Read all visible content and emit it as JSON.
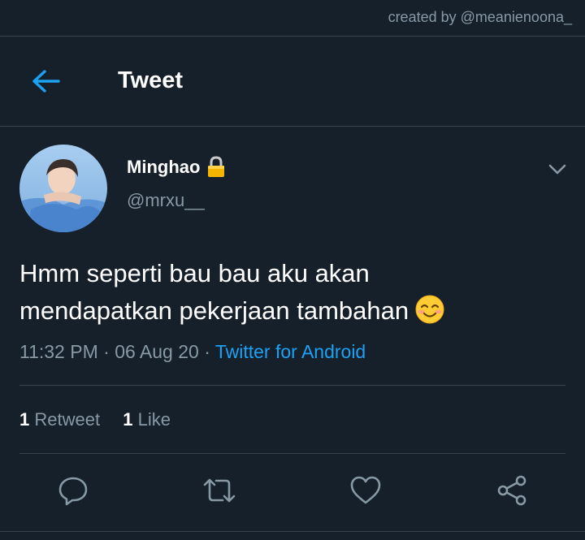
{
  "credit": "created by @meanienoona_",
  "header": {
    "title": "Tweet",
    "back_icon": "arrow-left-icon"
  },
  "tweet": {
    "display_name": "Minghao",
    "protected_icon": "lock-icon",
    "handle": "@mrxu__",
    "text_lines": [
      "Hmm seperti bau bau aku akan",
      "mendapatkan pekerjaan tambahan"
    ],
    "emoji": "smiling-face-icon",
    "time": "11:32 PM",
    "date": "06 Aug 20",
    "separator": "·",
    "source": "Twitter for Android",
    "retweets": {
      "count": "1",
      "label": "Retweet"
    },
    "likes": {
      "count": "1",
      "label": "Like"
    }
  },
  "actions": [
    "reply-icon",
    "retweet-icon",
    "like-icon",
    "share-icon"
  ],
  "colors": {
    "background": "#15202b",
    "accent": "#1da1f2",
    "secondary_text": "#8899a6",
    "divider": "#38444d"
  }
}
